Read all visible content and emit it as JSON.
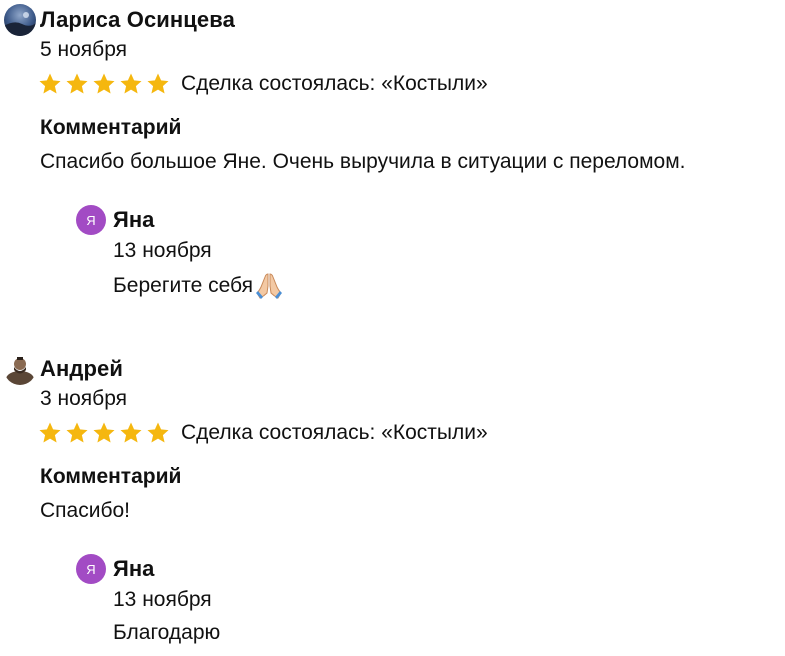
{
  "colors": {
    "star": "#f5b70f",
    "reply_avatar_bg": "#a24bc4",
    "text": "#111111"
  },
  "reviews": [
    {
      "author": "Лариса Осинцева",
      "avatar_icon": "user-photo-avatar-landscape",
      "date": "5 ноября",
      "rating": 5,
      "deal_text": "Сделка состоялась: «Костыли»",
      "comment_label": "Комментарий",
      "comment": "Спасибо большое Яне. Очень выручила в ситуации с переломом.",
      "reply": {
        "avatar_letter": "Я",
        "author": "Яна",
        "date": "13 ноября",
        "text": "Берегите себя",
        "emoji_icon": "praying-hands-icon"
      }
    },
    {
      "author": "Андрей",
      "avatar_icon": "user-photo-avatar-warrior",
      "date": "3 ноября",
      "rating": 5,
      "deal_text": "Сделка состоялась: «Костыли»",
      "comment_label": "Комментарий",
      "comment": "Спасибо!",
      "reply": {
        "avatar_letter": "Я",
        "author": "Яна",
        "date": "13 ноября",
        "text": "Благодарю"
      }
    }
  ]
}
